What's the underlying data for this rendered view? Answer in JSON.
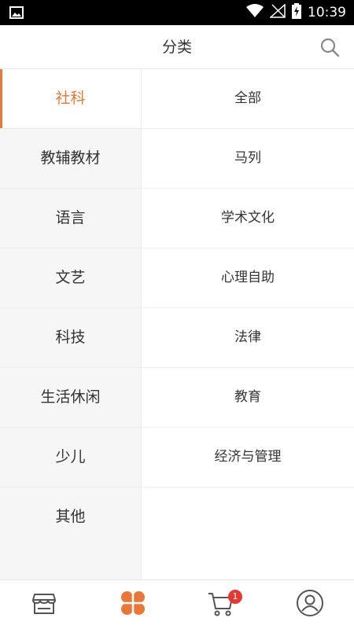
{
  "status_bar": {
    "time": "10:39"
  },
  "header": {
    "title": "分类"
  },
  "categories": [
    {
      "label": "社科",
      "active": true
    },
    {
      "label": "教辅教材"
    },
    {
      "label": "语言"
    },
    {
      "label": "文艺"
    },
    {
      "label": "科技"
    },
    {
      "label": "生活休闲"
    },
    {
      "label": "少儿"
    },
    {
      "label": "其他"
    }
  ],
  "subcategories": [
    "全部",
    "马列",
    "学术文化",
    "心理自助",
    "法律",
    "教育",
    "经济与管理"
  ],
  "tabbar": {
    "tabs": [
      {
        "icon": "store-icon",
        "active": false
      },
      {
        "icon": "category-icon",
        "active": true
      },
      {
        "icon": "cart-icon",
        "active": false
      },
      {
        "icon": "user-icon",
        "active": false
      }
    ],
    "cart_badge": "1"
  },
  "colors": {
    "accent": "#e8783a",
    "badge": "#e53935"
  }
}
